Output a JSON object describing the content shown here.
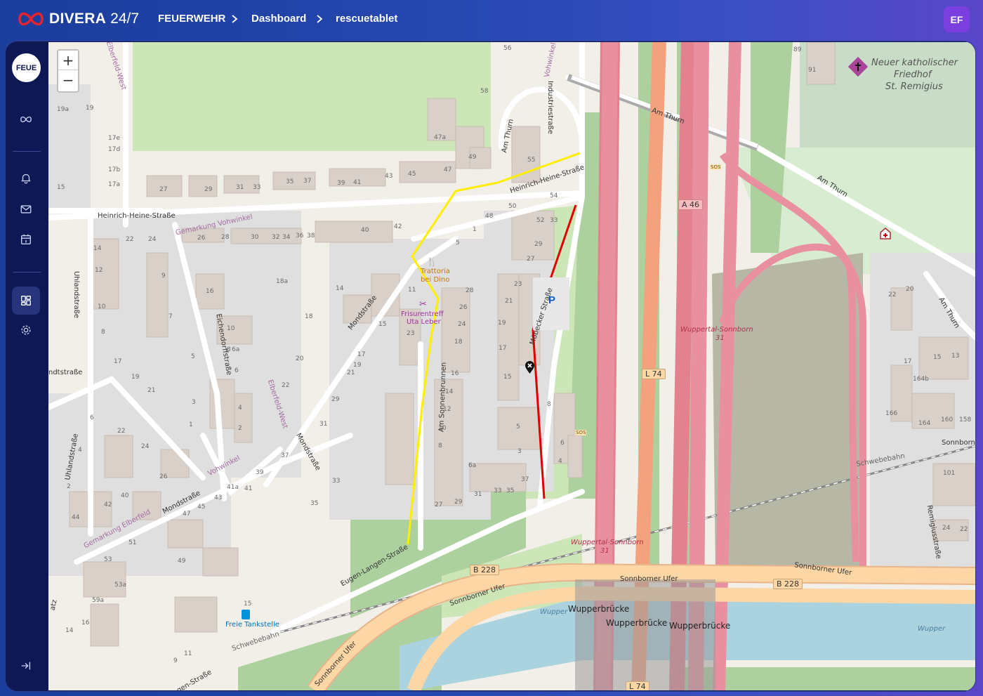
{
  "header": {
    "brand": "DIVERA",
    "version": "24/7",
    "breadcrumb": [
      "FEUERWEHR",
      "Dashboard",
      "rescuetablet"
    ],
    "user_initials": "EF"
  },
  "sidebar": {
    "workspace_label": "FEUE",
    "items": [
      {
        "name": "infinity-icon"
      },
      {
        "name": "bell-icon"
      },
      {
        "name": "mail-icon"
      },
      {
        "name": "calendar-icon"
      },
      {
        "name": "dashboard-icon",
        "active": true
      },
      {
        "name": "gear-icon"
      },
      {
        "name": "collapse-icon"
      }
    ]
  },
  "map": {
    "zoom_in": "+",
    "zoom_out": "−",
    "streets": {
      "heinrich_heine_1": "Heinrich-Heine-Straße",
      "heinrich_heine_2": "Heinrich-Heine-Straße",
      "industriestrasse": "Industriestraße",
      "am_thurn_1": "Am Thurn",
      "am_thurn_2": "Am Thurn",
      "am_thurn_3": "Am Thurn",
      "am_thurn_4": "Am Thurn",
      "mondstrasse_1": "Mondstraße",
      "mondstrasse_2": "Mondstraße",
      "mondstrasse_3": "Mondstraße",
      "uhlandstrasse_1": "Uhlandstraße",
      "uhlandstrasse_2": "Uhlandstraße",
      "eichendorffstrasse": "Eichendorffstraße",
      "moebecker": "Möbecker Straße",
      "am_sonnenbrunnen": "Am Sonnenbrunnen",
      "eugen_langen": "Eugen-Langen-Straße",
      "sonnborner_ufer_1": "Sonnborner Ufer",
      "sonnborner_ufer_2": "Sonnborner Ufer",
      "sonnborner_ufer_3": "Sonnborner Ufer",
      "sonnborner_ufer_4": "Sonnborner Ufer",
      "remigiusstrasse": "Remigiusstraße",
      "elberfeld_west_1": "Elberfeld-West",
      "elberfeld_west_2": "Elberfeld-West",
      "gemarkung_vohwinkel_1": "Gemarkung Vohwinkel",
      "gemarkung_vohwinkel_2": "Vohwinkel",
      "gemarkung_elberfeld": "Gemarkung Elberfeld",
      "schwebebahn_1": "Schwebebahn",
      "schwebebahn_2": "Schwebebahn",
      "wupper_1": "Wupper",
      "wupper_2": "Wupper",
      "wupperbruecke_1": "Wupperbrücke",
      "wupperbruecke_2": "Wupperbrücke",
      "wupperbruecke_3": "Wupperbrücke",
      "sonnborn": "Sonnborn",
      "vohwinkel_top": "Vohwinkel",
      "ndtstrasse": "ndtstraße",
      "atz": "atz",
      "gen_strasse": "gen-Straße"
    },
    "pois": {
      "friedhof_1": "Neuer katholischer",
      "friedhof_2": "Friedhof",
      "friedhof_3": "St. Remigius",
      "trattoria_1": "Trattoria",
      "trattoria_2": "bei Dino",
      "frisur_1": "Frisurentreff",
      "frisur_2": "Uta Leber",
      "tankstelle": "Freie Tankstelle",
      "junction_1": "Wuppertal-Sonnborn",
      "junction_1_num": "31",
      "junction_2": "Wuppertal-Sonnborn",
      "junction_2_num": "31",
      "parking": "P",
      "sos_1": "SOS",
      "sos_2": "SOS"
    },
    "shields": {
      "a46": "A 46",
      "l74_1": "L 74",
      "l74_2": "L 74",
      "b228_1": "B 228",
      "b228_2": "B 228"
    },
    "house_numbers": [
      "56",
      "58",
      "47a",
      "49",
      "47",
      "55",
      "54",
      "50",
      "48",
      "52",
      "33",
      "29",
      "27",
      "23",
      "21",
      "19",
      "17",
      "15",
      "8",
      "6",
      "4",
      "5",
      "3",
      "37",
      "35",
      "33",
      "31",
      "29",
      "27",
      "6a",
      "8",
      "10",
      "12",
      "14",
      "16",
      "18",
      "24",
      "26",
      "28",
      "11",
      "1",
      "5",
      "19a",
      "19",
      "17e",
      "17d",
      "17b",
      "17a",
      "15",
      "27",
      "29",
      "31",
      "33",
      "35",
      "37",
      "39",
      "41",
      "43",
      "45",
      "22",
      "24",
      "26",
      "28",
      "30",
      "32",
      "34",
      "36",
      "38",
      "40",
      "42",
      "14",
      "12",
      "10",
      "8",
      "9",
      "7",
      "5",
      "3",
      "1",
      "18a",
      "16",
      "14",
      "18",
      "15",
      "17",
      "19",
      "21",
      "23",
      "20",
      "22",
      "10",
      "8",
      "6a",
      "6",
      "4",
      "2",
      "29",
      "31",
      "33",
      "35",
      "37",
      "39",
      "41a",
      "41",
      "43",
      "45",
      "47",
      "49",
      "51",
      "53",
      "53a",
      "59a",
      "16",
      "14",
      "15",
      "9",
      "11",
      "44",
      "42",
      "40",
      "2",
      "4",
      "6",
      "22",
      "24",
      "26",
      "21",
      "19",
      "17",
      "89",
      "91",
      "22",
      "20",
      "17",
      "15",
      "13",
      "164b",
      "166",
      "164",
      "160",
      "158",
      "101",
      "24",
      "22"
    ]
  }
}
